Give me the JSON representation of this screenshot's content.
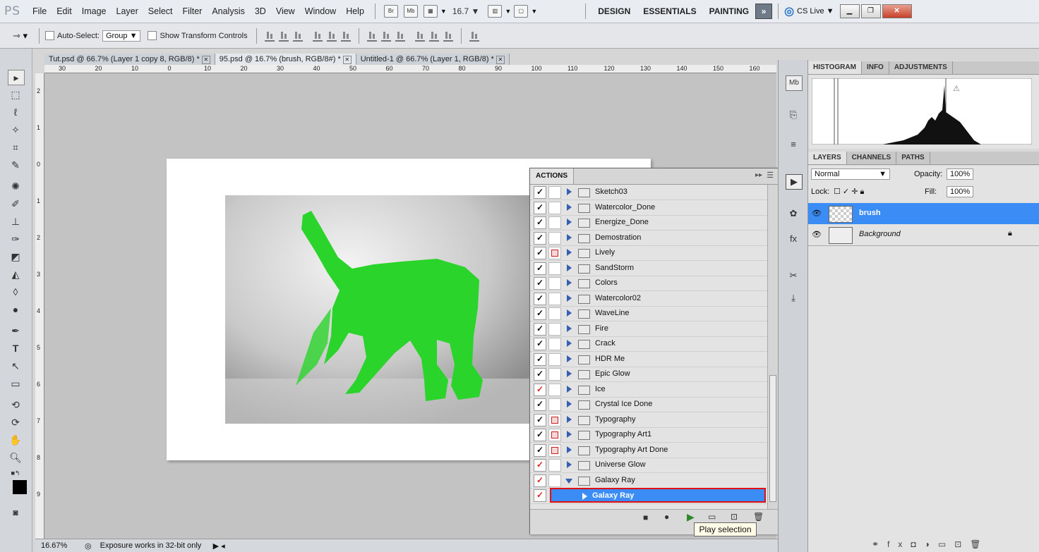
{
  "app": {
    "logo": "PS"
  },
  "menu": [
    "File",
    "Edit",
    "Image",
    "Layer",
    "Select",
    "Filter",
    "Analysis",
    "3D",
    "View",
    "Window",
    "Help"
  ],
  "menu_minis": {
    "bridge": "Br",
    "minibridge": "Mb"
  },
  "zoom_dropdown": "16.7",
  "workspaces": [
    "DESIGN",
    "ESSENTIALS",
    "PAINTING"
  ],
  "cslive": "CS Live",
  "options": {
    "auto_select": "Auto-Select:",
    "group": "Group",
    "transform": "Show Transform Controls"
  },
  "tabs": [
    "Tut.psd @ 66.7% (Layer 1 copy 8, RGB/8) *",
    "95.psd @ 16.7% (brush, RGB/8#) *",
    "Untitled-1 @ 66.7% (Layer 1, RGB/8) *"
  ],
  "ruler_h": [
    "30",
    "20",
    "10",
    "0",
    "10",
    "20",
    "30",
    "40",
    "50",
    "60",
    "70",
    "80",
    "90",
    "100",
    "110",
    "120",
    "130",
    "140",
    "150",
    "160"
  ],
  "ruler_v": [
    "2",
    "1",
    "0",
    "1",
    "2",
    "3",
    "4",
    "5",
    "6",
    "7",
    "8",
    "9"
  ],
  "actions": {
    "title": "ACTIONS",
    "items": [
      {
        "label": "Sketch03",
        "dlg": false,
        "red": false
      },
      {
        "label": "Watercolor_Done",
        "dlg": false,
        "red": false
      },
      {
        "label": "Energize_Done",
        "dlg": false,
        "red": false
      },
      {
        "label": "Demostration",
        "dlg": false,
        "red": false
      },
      {
        "label": "Lively",
        "dlg": true,
        "red": false
      },
      {
        "label": "SandStorm",
        "dlg": false,
        "red": false
      },
      {
        "label": "Colors",
        "dlg": false,
        "red": false
      },
      {
        "label": "Watercolor02",
        "dlg": false,
        "red": false
      },
      {
        "label": "WaveLine",
        "dlg": false,
        "red": false
      },
      {
        "label": "Fire",
        "dlg": false,
        "red": false
      },
      {
        "label": "Crack",
        "dlg": false,
        "red": false
      },
      {
        "label": "HDR Me",
        "dlg": false,
        "red": false
      },
      {
        "label": "Epic Glow",
        "dlg": false,
        "red": false
      },
      {
        "label": "Ice",
        "dlg": false,
        "red": true
      },
      {
        "label": "Crystal Ice Done",
        "dlg": false,
        "red": false
      },
      {
        "label": "Typography",
        "dlg": true,
        "red": false
      },
      {
        "label": "Typography Art1",
        "dlg": true,
        "red": false
      },
      {
        "label": "Typography Art Done",
        "dlg": true,
        "red": false
      },
      {
        "label": "Universe Glow",
        "dlg": false,
        "red": true
      },
      {
        "label": "Galaxy Ray",
        "dlg": false,
        "red": true,
        "open": true
      }
    ],
    "selected": "Galaxy Ray"
  },
  "tooltip": "Play selection",
  "histogram_tabs": [
    "HISTOGRAM",
    "INFO",
    "ADJUSTMENTS"
  ],
  "layers_tabs": [
    "LAYERS",
    "CHANNELS",
    "PATHS"
  ],
  "layers": {
    "blend": "Normal",
    "opacity_label": "Opacity:",
    "opacity": "100%",
    "lock_label": "Lock:",
    "fill_label": "Fill:",
    "fill": "100%",
    "items": [
      {
        "name": "brush",
        "selected": true
      },
      {
        "name": "Background",
        "selected": false
      }
    ]
  },
  "status": {
    "zoom": "16.67%",
    "message": "Exposure works in 32-bit only"
  },
  "colors": {
    "accent": "#3b8cf4",
    "silhouette": "#2bd42b",
    "highlight": "#e01010"
  }
}
